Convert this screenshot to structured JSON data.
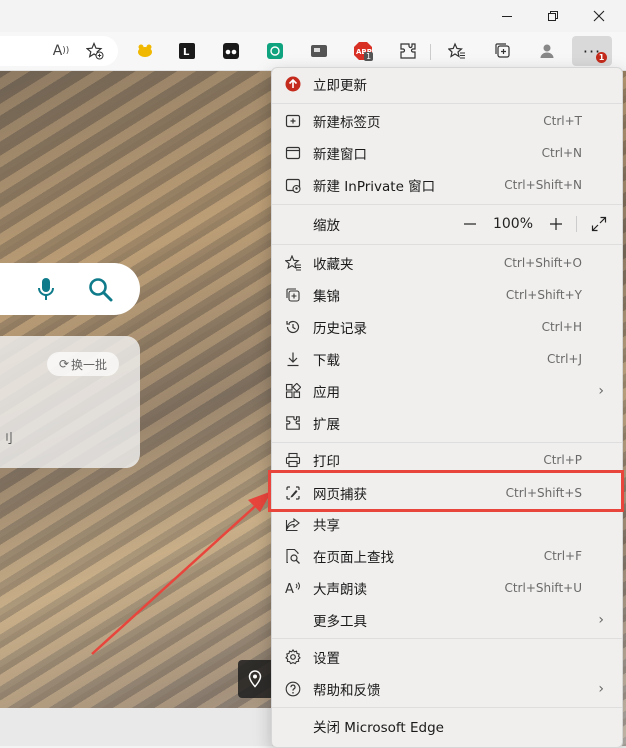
{
  "window": {
    "minimize_icon": "minimize-icon",
    "maximize_icon": "restore-icon",
    "close_icon": "close-icon"
  },
  "toolbar": {
    "read_aloud_text": "A",
    "notification_count": "1",
    "more_badge": "1"
  },
  "content": {
    "refresh_label": "换一批",
    "card_fragment": "刂"
  },
  "menu": {
    "update": "立即更新",
    "new_tab": {
      "label": "新建标签页",
      "shortcut": "Ctrl+T"
    },
    "new_window": {
      "label": "新建窗口",
      "shortcut": "Ctrl+N"
    },
    "new_inprivate": {
      "label": "新建 InPrivate 窗口",
      "shortcut": "Ctrl+Shift+N"
    },
    "zoom": {
      "label": "缩放",
      "minus": "—",
      "value": "100%",
      "plus": "+"
    },
    "favorites": {
      "label": "收藏夹",
      "shortcut": "Ctrl+Shift+O"
    },
    "collections": {
      "label": "集锦",
      "shortcut": "Ctrl+Shift+Y"
    },
    "history": {
      "label": "历史记录",
      "shortcut": "Ctrl+H"
    },
    "downloads": {
      "label": "下载",
      "shortcut": "Ctrl+J"
    },
    "apps": {
      "label": "应用"
    },
    "extensions": {
      "label": "扩展"
    },
    "print": {
      "label": "打印",
      "shortcut": "Ctrl+P"
    },
    "web_capture": {
      "label": "网页捕获",
      "shortcut": "Ctrl+Shift+S"
    },
    "share": {
      "label": "共享"
    },
    "find": {
      "label": "在页面上查找",
      "shortcut": "Ctrl+F"
    },
    "read_aloud": {
      "label": "大声朗读",
      "shortcut": "Ctrl+Shift+U"
    },
    "more_tools": {
      "label": "更多工具"
    },
    "settings": {
      "label": "设置"
    },
    "help": {
      "label": "帮助和反馈"
    },
    "close_edge": {
      "label": "关闭 Microsoft Edge"
    }
  },
  "colors": {
    "highlight": "#e8453c",
    "arrow": "#e8453c",
    "update_badge": "#c42b1c",
    "accent": "#0f7b8a"
  }
}
